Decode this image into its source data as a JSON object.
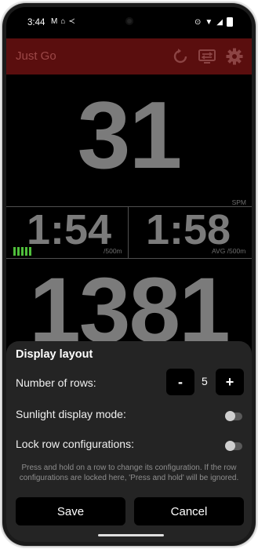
{
  "status": {
    "time": "3:44"
  },
  "app": {
    "title": "Just Go"
  },
  "metrics": {
    "spm_value": "31",
    "spm_unit": "SPM",
    "split_value": "1:54",
    "split_unit": "/500m",
    "avg_split_value": "1:58",
    "avg_split_unit": "AVG /500m",
    "distance_value": "1381"
  },
  "sheet": {
    "title": "Display layout",
    "rows_label": "Number of rows:",
    "rows_value": "5",
    "minus_label": "-",
    "plus_label": "+",
    "sunlight_label": "Sunlight display mode:",
    "lock_label": "Lock row configurations:",
    "note": "Press and hold on a row to change its configuration. If the row configurations are locked here, 'Press and hold' will be ignored.",
    "save_label": "Save",
    "cancel_label": "Cancel"
  },
  "icons": [
    "refresh-icon",
    "display-settings-icon",
    "gear-icon"
  ],
  "colors": {
    "appbar": "#5a0e0e",
    "sheet": "#242424",
    "stroke_bars": "#4fbf3b"
  }
}
